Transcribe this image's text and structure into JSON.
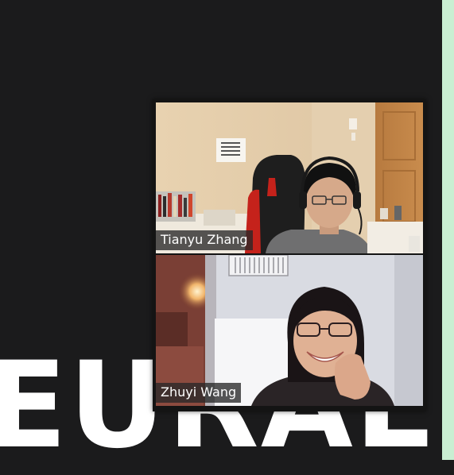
{
  "slide": {
    "title_fragment": "EURAL"
  },
  "participants": [
    {
      "name": "Tianyu Zhang",
      "avatar_icon": "video-feed-participant-1"
    },
    {
      "name": "Zhuyi Wang",
      "avatar_icon": "video-feed-participant-2"
    }
  ],
  "colors": {
    "slide_background": "#1b1b1c",
    "edge_strip": "#c9eed2",
    "name_label_bg": "#282828"
  }
}
